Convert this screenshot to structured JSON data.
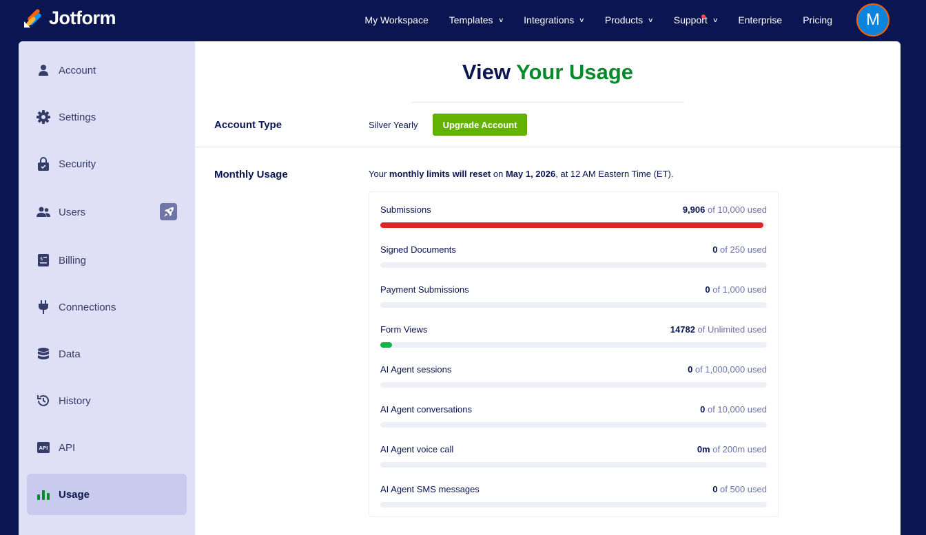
{
  "brand": {
    "name": "Jotform"
  },
  "topnav": {
    "items": [
      {
        "label": "My Workspace",
        "has_menu": false
      },
      {
        "label": "Templates",
        "has_menu": true
      },
      {
        "label": "Integrations",
        "has_menu": true
      },
      {
        "label": "Products",
        "has_menu": true
      },
      {
        "label": "Support",
        "has_menu": true,
        "has_notification": true
      },
      {
        "label": "Enterprise",
        "has_menu": false
      },
      {
        "label": "Pricing",
        "has_menu": false
      }
    ],
    "avatar_initial": "M"
  },
  "sidebar": {
    "items": [
      {
        "label": "Account",
        "icon": "user-icon"
      },
      {
        "label": "Settings",
        "icon": "gear-icon"
      },
      {
        "label": "Security",
        "icon": "lock-icon"
      },
      {
        "label": "Users",
        "icon": "users-icon",
        "badge_icon": "rocket-icon"
      },
      {
        "label": "Billing",
        "icon": "billing-icon"
      },
      {
        "label": "Connections",
        "icon": "plug-icon"
      },
      {
        "label": "Data",
        "icon": "database-icon"
      },
      {
        "label": "History",
        "icon": "history-icon"
      },
      {
        "label": "API",
        "icon": "api-icon"
      },
      {
        "label": "Usage",
        "icon": "bar-chart-icon",
        "active": true
      }
    ]
  },
  "main": {
    "title_part1": "View",
    "title_part2": "Your Usage",
    "account_type_label": "Account Type",
    "plan_name": "Silver Yearly",
    "upgrade_label": "Upgrade Account",
    "monthly_usage_label": "Monthly Usage",
    "reset": {
      "t1": "Your ",
      "t2": "monthly limits will reset",
      "t3": " on ",
      "t4": "May 1, 2026",
      "t5": ", at 12 AM Eastern Time (ET)."
    },
    "usage": [
      {
        "name": "Submissions",
        "used": "9,906",
        "of_text": " of 10,000 used",
        "fraction": 0.9906,
        "color": "#dc2626"
      },
      {
        "name": "Signed Documents",
        "used": "0",
        "of_text": " of 250 used",
        "fraction": 0,
        "color": "#dc2626"
      },
      {
        "name": "Payment Submissions",
        "used": "0",
        "of_text": " of 1,000 used",
        "fraction": 0,
        "color": "#dc2626"
      },
      {
        "name": "Form Views",
        "used": "14782",
        "of_text": " of Unlimited used",
        "fraction": 0.03,
        "color": "#18b24b"
      },
      {
        "name": "AI Agent sessions",
        "used": "0",
        "of_text": " of 1,000,000 used",
        "fraction": 0,
        "color": "#dc2626"
      },
      {
        "name": "AI Agent conversations",
        "used": "0",
        "of_text": " of 10,000 used",
        "fraction": 0,
        "color": "#dc2626"
      },
      {
        "name": "AI Agent voice call",
        "used": "0m",
        "of_text": " of 200m used",
        "fraction": 0,
        "color": "#dc2626"
      },
      {
        "name": "AI Agent SMS messages",
        "used": "0",
        "of_text": " of 500 used",
        "fraction": 0,
        "color": "#dc2626"
      }
    ]
  },
  "colors": {
    "nav_bg": "#0a1551",
    "accent_green": "#078a2b",
    "upgrade_green": "#64b200",
    "sidebar_bg": "#dfe0f5"
  }
}
